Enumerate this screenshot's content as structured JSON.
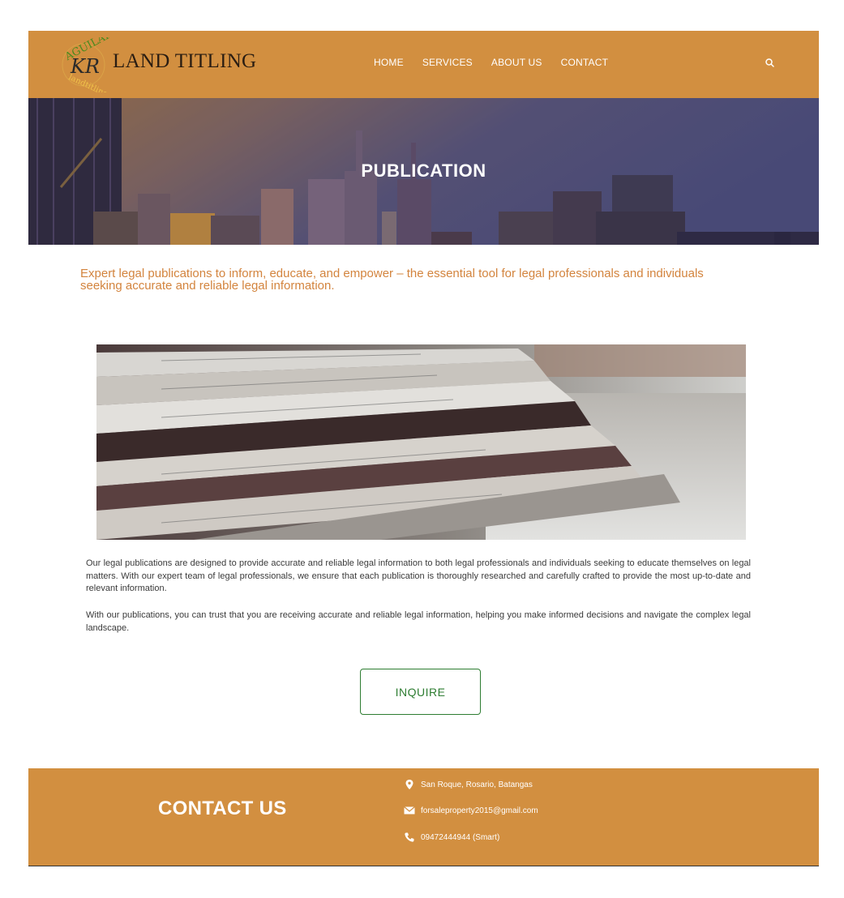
{
  "header": {
    "logo_text": "AGUILAR KR landtitling",
    "brand": "LAND TITLING",
    "nav": [
      "HOME",
      "SERVICES",
      "ABOUT US",
      "CONTACT"
    ],
    "search_icon": "search-icon",
    "background": "#d28f40"
  },
  "hero": {
    "title": "PUBLICATION"
  },
  "intro": {
    "tagline": "Expert legal publications to inform, educate, and empower – the essential tool for legal professionals and individuals seeking accurate and reliable legal information."
  },
  "content": {
    "paragraph1": "Our legal publications are designed to provide accurate and reliable legal information to both legal professionals and individuals seeking to educate themselves on legal matters. With our expert team of legal professionals, we ensure that each publication is thoroughly researched and carefully crafted to provide the most up-to-date and relevant information.",
    "paragraph2": "With our publications, you can trust that you are receiving accurate and reliable legal information, helping you make informed decisions and navigate the complex legal landscape.",
    "inquire_label": "INQUIRE"
  },
  "footer": {
    "title": "CONTACT US",
    "address": "San Roque, Rosario, Batangas",
    "email": "forsaleproperty2015@gmail.com",
    "phone": "09472444944 (Smart)",
    "icons": [
      "map-pin-icon",
      "envelope-icon",
      "phone-icon"
    ]
  },
  "colors": {
    "accent": "#d28f40",
    "tagline": "#d3843e",
    "button": "#2e7d32"
  }
}
